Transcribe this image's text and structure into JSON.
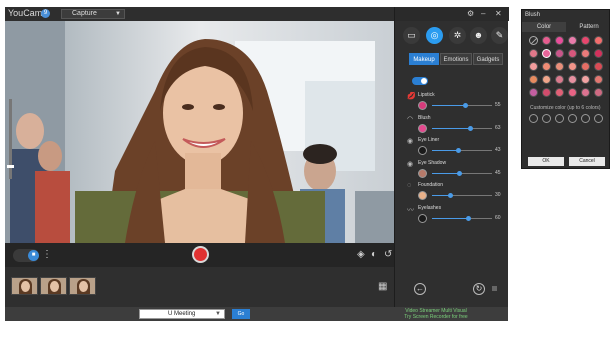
{
  "app": {
    "title": "YouCam",
    "version_badge": "9",
    "mode": "Capture"
  },
  "control_bar": {
    "camera_toggle_icon": "camera-icon",
    "icons": [
      "layers-icon",
      "effects-icon",
      "rotate-icon"
    ]
  },
  "film_strip": {
    "thumbnails": 3,
    "grid_icon": "grid-icon"
  },
  "bottom_bar": {
    "app_select": "U Meeting",
    "go_label": "Go",
    "promo_line1": "Video Streamer Multi Visual",
    "promo_line2": "Try Screen Recorder for free"
  },
  "panel": {
    "tabs": [
      "Makeup",
      "Emotions",
      "Gadgets"
    ],
    "active_tab": "Makeup",
    "top_icons": [
      "frame-icon",
      "beauty-icon",
      "effect-icon",
      "avatar-icon",
      "brush-icon"
    ],
    "features": [
      {
        "label": "Lipstick",
        "color": "#d63c7c",
        "value": "55"
      },
      {
        "label": "Blush",
        "color": "#e44a8f",
        "value": "63"
      },
      {
        "label": "Eye Liner",
        "color": "#1a1a1a",
        "value": "43"
      },
      {
        "label": "Eye Shadow",
        "color": "#b67a6a",
        "value": "45"
      },
      {
        "label": "Foundation",
        "color": "#e8b089",
        "value": "30"
      },
      {
        "label": "Eyelashes",
        "color": "#1a1a1a",
        "value": "60"
      }
    ]
  },
  "blush_dialog": {
    "title": "Blush",
    "tabs": [
      "Color",
      "Pattern"
    ],
    "active_tab": "Color",
    "palette": [
      [
        "none",
        "#e65d8f",
        "#e84e9a",
        "#e97cab",
        "#e6466d",
        "#f26d6d"
      ],
      [
        "#e1788a",
        "#e8659a",
        "#c9568a",
        "#d8577c",
        "#ea7b7b",
        "#d4315c"
      ],
      [
        "#f29c9c",
        "#ef8b74",
        "#e98f7a",
        "#f29489",
        "#e46d64",
        "#d94b55"
      ],
      [
        "#e78b5f",
        "#f1a58a",
        "#d97a8d",
        "#e690a0",
        "#f0a2a2",
        "#e37771"
      ],
      [
        "#c35fa1",
        "#d14c6c",
        "#e16076",
        "#e86384",
        "#db7290",
        "#cf6a82"
      ]
    ],
    "custom_label": "Customize color (up to 6 colors)",
    "ok_label": "OK",
    "cancel_label": "Cancel"
  }
}
